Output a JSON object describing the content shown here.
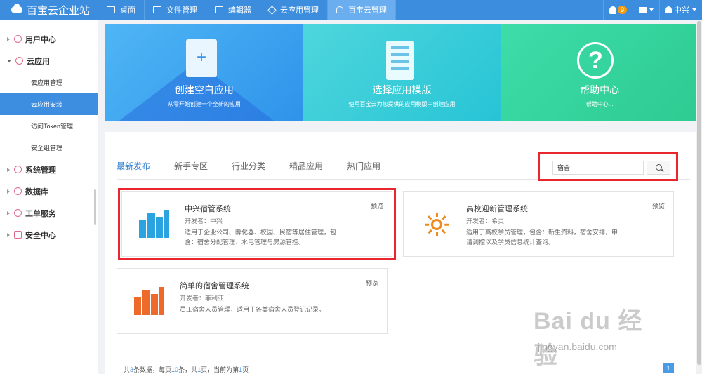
{
  "app": {
    "title": "百宝云企业站"
  },
  "topnav": {
    "items": [
      {
        "label": "桌面",
        "icon": "monitor-icon"
      },
      {
        "label": "文件管理",
        "icon": "folder-icon"
      },
      {
        "label": "编辑器",
        "icon": "edit-icon"
      },
      {
        "label": "云应用管理",
        "icon": "cube-icon"
      },
      {
        "label": "百宝云管理",
        "icon": "user-icon"
      }
    ],
    "notification_count": "9",
    "user_name": "中兴"
  },
  "sidebar": {
    "items": [
      {
        "label": "用户中心"
      },
      {
        "label": "云应用"
      },
      {
        "label": "系统管理"
      },
      {
        "label": "数据库"
      },
      {
        "label": "工单服务"
      },
      {
        "label": "安全中心"
      }
    ],
    "subitems": [
      {
        "label": "云应用管理"
      },
      {
        "label": "云应用安装"
      },
      {
        "label": "访问Token管理"
      },
      {
        "label": "安全组管理"
      }
    ]
  },
  "banner": {
    "panels": [
      {
        "title": "创建空白应用",
        "subtitle": "从零开始创建一个全新的应用"
      },
      {
        "title": "选择应用模版",
        "subtitle": "使用百宝云为您提供的应用模版中创建应用"
      },
      {
        "title": "帮助中心",
        "subtitle": "帮助中心..."
      }
    ]
  },
  "tabs": [
    {
      "label": "最新发布"
    },
    {
      "label": "新手专区"
    },
    {
      "label": "行业分类"
    },
    {
      "label": "精品应用"
    },
    {
      "label": "热门应用"
    }
  ],
  "search": {
    "value": "宿舍"
  },
  "cards": [
    {
      "title": "中兴宿管系统",
      "developer": "开发者：中兴",
      "description": "适用于企业公司、孵化器、校园、民宿等居住管理，包含：宿舍分配管理、水电管理与房源管控。",
      "preview": "预览"
    },
    {
      "title": "高校迎新管理系统",
      "developer": "开发者：希灵",
      "description": "适用于高校学员管理，包含：新生资料，宿舍安排，申请调控以及学员信息统计查询。",
      "preview": "预览"
    },
    {
      "title": "简单的宿舍管理系统",
      "developer": "开发者：菲利亚",
      "description": "员工宿舍人员管理，适用于各类宿舍人员登记记录。",
      "preview": "预览"
    }
  ],
  "pagination": {
    "prefix": "共",
    "total": "3",
    "mid1": "条数据，每页",
    "per_page": "10",
    "mid2": "条，共",
    "pages": "1",
    "mid3": "页，当前为第",
    "current": "1",
    "suffix": "页",
    "current_button": "1"
  },
  "watermark": {
    "line1": "Bai du 经验",
    "line2": "jingyan.baidu.com"
  },
  "colors": {
    "topbar": "#3c8dde",
    "accent": "#3d8ee0",
    "highlight": "#e8262e"
  }
}
